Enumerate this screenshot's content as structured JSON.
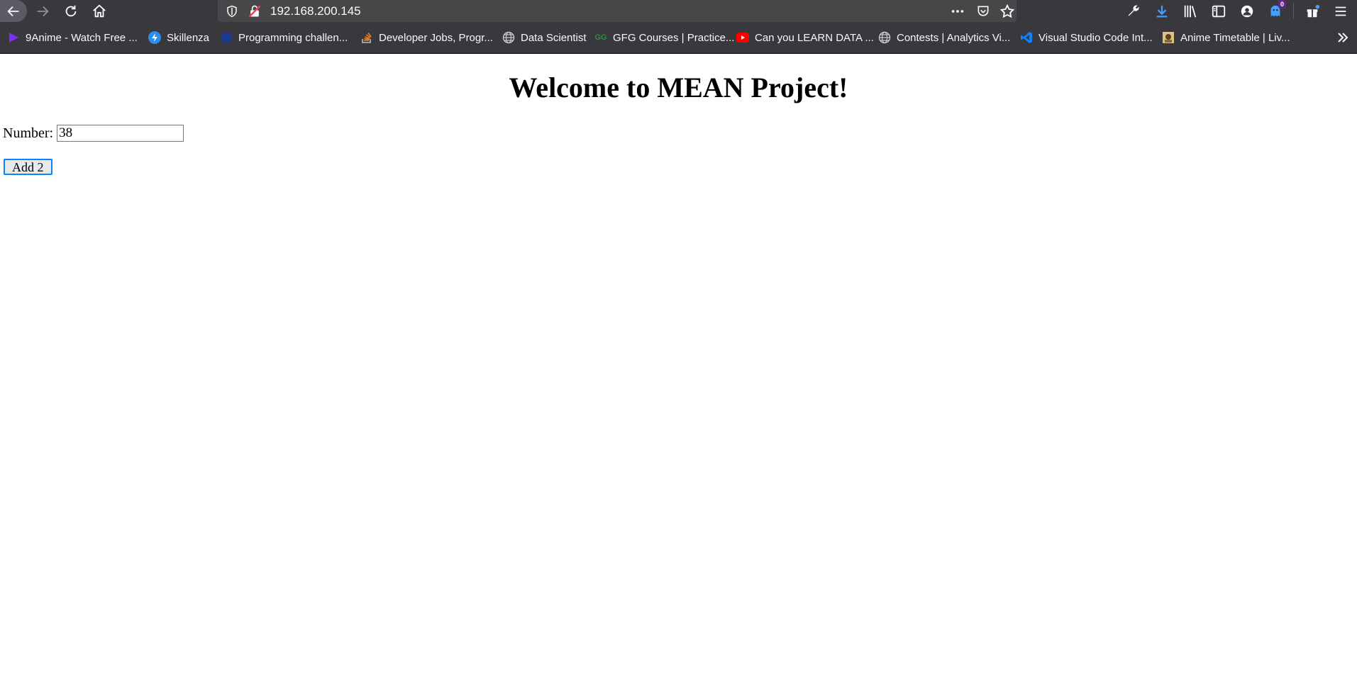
{
  "browser": {
    "url": "192.168.200.145",
    "notification_count": "0",
    "bookmarks": [
      {
        "label": "9Anime - Watch Free ...",
        "icon": "play-triangle-icon",
        "color": "#7b2ff7"
      },
      {
        "label": "Skillenza",
        "icon": "skillenza-icon",
        "color": "#2d8cf0"
      },
      {
        "label": "Programming challen...",
        "icon": "globe-dark-icon",
        "color": "#1e3a8a"
      },
      {
        "label": "Developer Jobs, Progr...",
        "icon": "stackoverflow-icon",
        "color": "#f48024"
      },
      {
        "label": "Data Scientist",
        "icon": "globe-icon",
        "color": "#cccccc"
      },
      {
        "label": "GFG Courses | Practice...",
        "icon": "gfg-icon",
        "color": "#2f8d46"
      },
      {
        "label": "Can you LEARN DATA ...",
        "icon": "youtube-icon",
        "color": "#ff0000"
      },
      {
        "label": "Contests | Analytics Vi...",
        "icon": "globe-icon",
        "color": "#cccccc"
      },
      {
        "label": "Visual Studio Code Int...",
        "icon": "vscode-icon",
        "color": "#0a84ff"
      },
      {
        "label": "Anime Timetable | Liv...",
        "icon": "anime-timetable-icon",
        "color": "#e0c080"
      }
    ]
  },
  "page": {
    "heading": "Welcome to MEAN Project!",
    "number_label": "Number:",
    "number_value": "38",
    "button_label": "Add 2"
  }
}
